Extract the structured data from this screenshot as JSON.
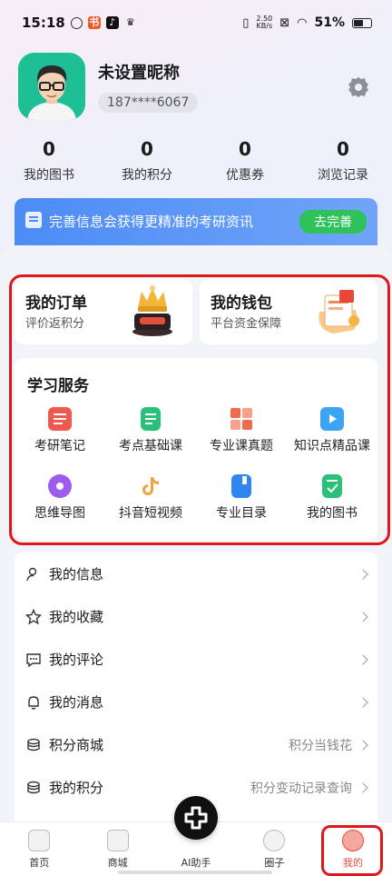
{
  "status_bar": {
    "time": "15:18",
    "net_speed_value": "2.50",
    "net_speed_unit": "KB/s",
    "battery": "51%"
  },
  "profile": {
    "nickname": "未设置昵称",
    "phone": "187****6067"
  },
  "stats": [
    {
      "value": "0",
      "label": "我的图书"
    },
    {
      "value": "0",
      "label": "我的积分"
    },
    {
      "value": "0",
      "label": "优惠券"
    },
    {
      "value": "0",
      "label": "浏览记录"
    }
  ],
  "banner": {
    "text": "完善信息会获得更精准的考研资讯",
    "button": "去完善"
  },
  "cards": {
    "order": {
      "title": "我的订单",
      "subtitle": "评价返积分"
    },
    "wallet": {
      "title": "我的钱包",
      "subtitle": "平台资金保障"
    }
  },
  "services": {
    "title": "学习服务",
    "items": [
      {
        "label": "考研笔记",
        "icon": "notebook-icon",
        "color": "#ef5a4f"
      },
      {
        "label": "考点基础课",
        "icon": "document-icon",
        "color": "#2bc07a"
      },
      {
        "label": "专业课真题",
        "icon": "calculator-icon",
        "color": "#f06a4f"
      },
      {
        "label": "知识点精品课",
        "icon": "video-icon",
        "color": "#3aa4f5"
      },
      {
        "label": "思维导图",
        "icon": "mindmap-icon",
        "color": "#9d5cf0"
      },
      {
        "label": "抖音短视频",
        "icon": "tiktok-icon",
        "color": "#f2a33a"
      },
      {
        "label": "专业目录",
        "icon": "book-icon",
        "color": "#2f86f0"
      },
      {
        "label": "我的图书",
        "icon": "book-check-icon",
        "color": "#2bc07a"
      }
    ]
  },
  "menu": [
    {
      "label": "我的信息",
      "icon": "user-icon",
      "right": ""
    },
    {
      "label": "我的收藏",
      "icon": "star-icon",
      "right": ""
    },
    {
      "label": "我的评论",
      "icon": "comment-icon",
      "right": ""
    },
    {
      "label": "我的消息",
      "icon": "bell-icon",
      "right": ""
    },
    {
      "label": "积分商城",
      "icon": "coins-icon",
      "right": "积分当钱花"
    },
    {
      "label": "我的积分",
      "icon": "coins-icon",
      "right": "积分变动记录查询"
    }
  ],
  "tabbar": [
    {
      "label": "首页",
      "icon": "home-icon"
    },
    {
      "label": "商城",
      "icon": "bag-icon"
    },
    {
      "label": "AI助手",
      "icon": "ai-icon"
    },
    {
      "label": "圈子",
      "icon": "planet-icon"
    },
    {
      "label": "我的",
      "icon": "mine-icon",
      "active": true
    }
  ],
  "colors": {
    "accent_blue": "#4d8cf5",
    "accent_green": "#2fc25b",
    "highlight_red": "#e0161e",
    "active_tab": "#e84b3c"
  }
}
